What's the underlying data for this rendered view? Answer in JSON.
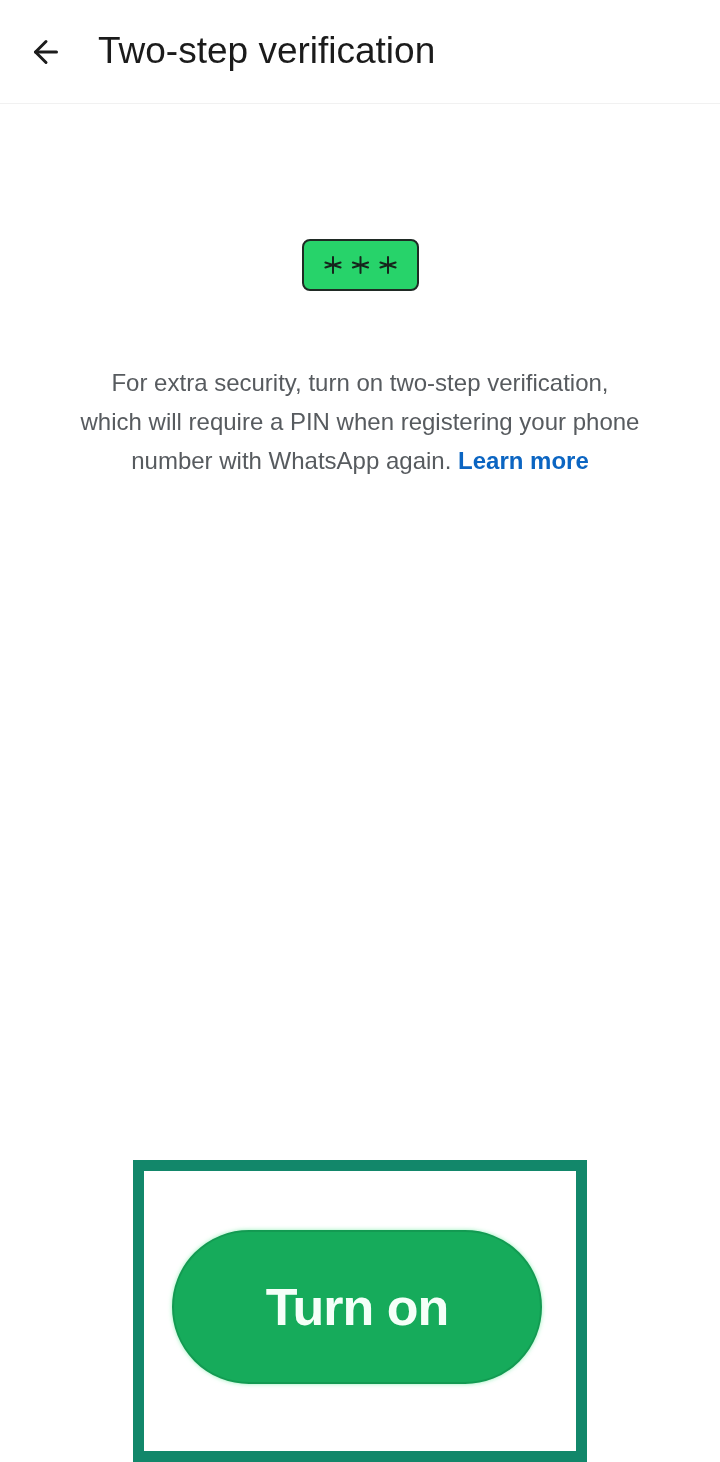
{
  "header": {
    "title": "Two-step verification"
  },
  "description": {
    "text": "For extra security, turn on two-step verification,\nwhich will require a PIN when registering your phone\nnumber with WhatsApp again.",
    "link": "Learn more"
  },
  "button": {
    "label": "Turn on",
    "highlighted": true
  }
}
